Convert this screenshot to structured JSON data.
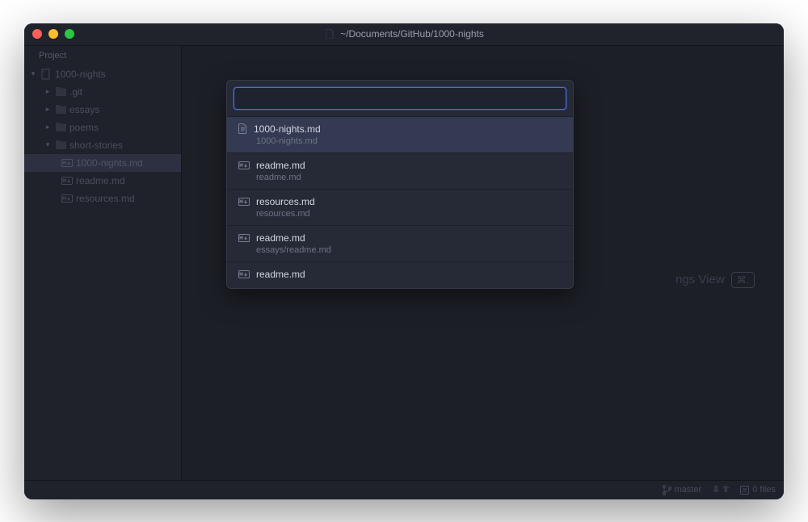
{
  "window": {
    "title": "~/Documents/GitHub/1000-nights"
  },
  "sidebar": {
    "header": "Project",
    "root": {
      "label": "1000-nights",
      "icon": "repo",
      "expanded": true
    },
    "items": [
      {
        "label": ".git",
        "icon": "folder",
        "hasChildren": true,
        "depth": 1
      },
      {
        "label": "essays",
        "icon": "folder",
        "hasChildren": true,
        "depth": 1
      },
      {
        "label": "poems",
        "icon": "folder",
        "hasChildren": true,
        "depth": 1
      },
      {
        "label": "short-stories",
        "icon": "folder",
        "hasChildren": true,
        "depth": 1
      },
      {
        "label": "1000-nights.md",
        "icon": "markdown",
        "hasChildren": false,
        "depth": 2,
        "selected": true
      },
      {
        "label": "readme.md",
        "icon": "markdown",
        "hasChildren": false,
        "depth": 2
      },
      {
        "label": "resources.md",
        "icon": "markdown",
        "hasChildren": false,
        "depth": 2
      }
    ]
  },
  "palette": {
    "placeholder": "",
    "value": "",
    "results": [
      {
        "name": "1000-nights.md",
        "path": "1000-nights.md",
        "icon": "file",
        "selected": true
      },
      {
        "name": "readme.md",
        "path": "readme.md",
        "icon": "markdown"
      },
      {
        "name": "resources.md",
        "path": "resources.md",
        "icon": "markdown"
      },
      {
        "name": "readme.md",
        "path": "essays/readme.md",
        "icon": "markdown"
      },
      {
        "name": "readme.md",
        "path": "",
        "icon": "markdown"
      }
    ]
  },
  "hint": {
    "text": "ngs View",
    "kbd": "⌘,"
  },
  "statusbar": {
    "branch": "master",
    "fetch_down": "",
    "fetch_up": "",
    "files": "0 files"
  }
}
